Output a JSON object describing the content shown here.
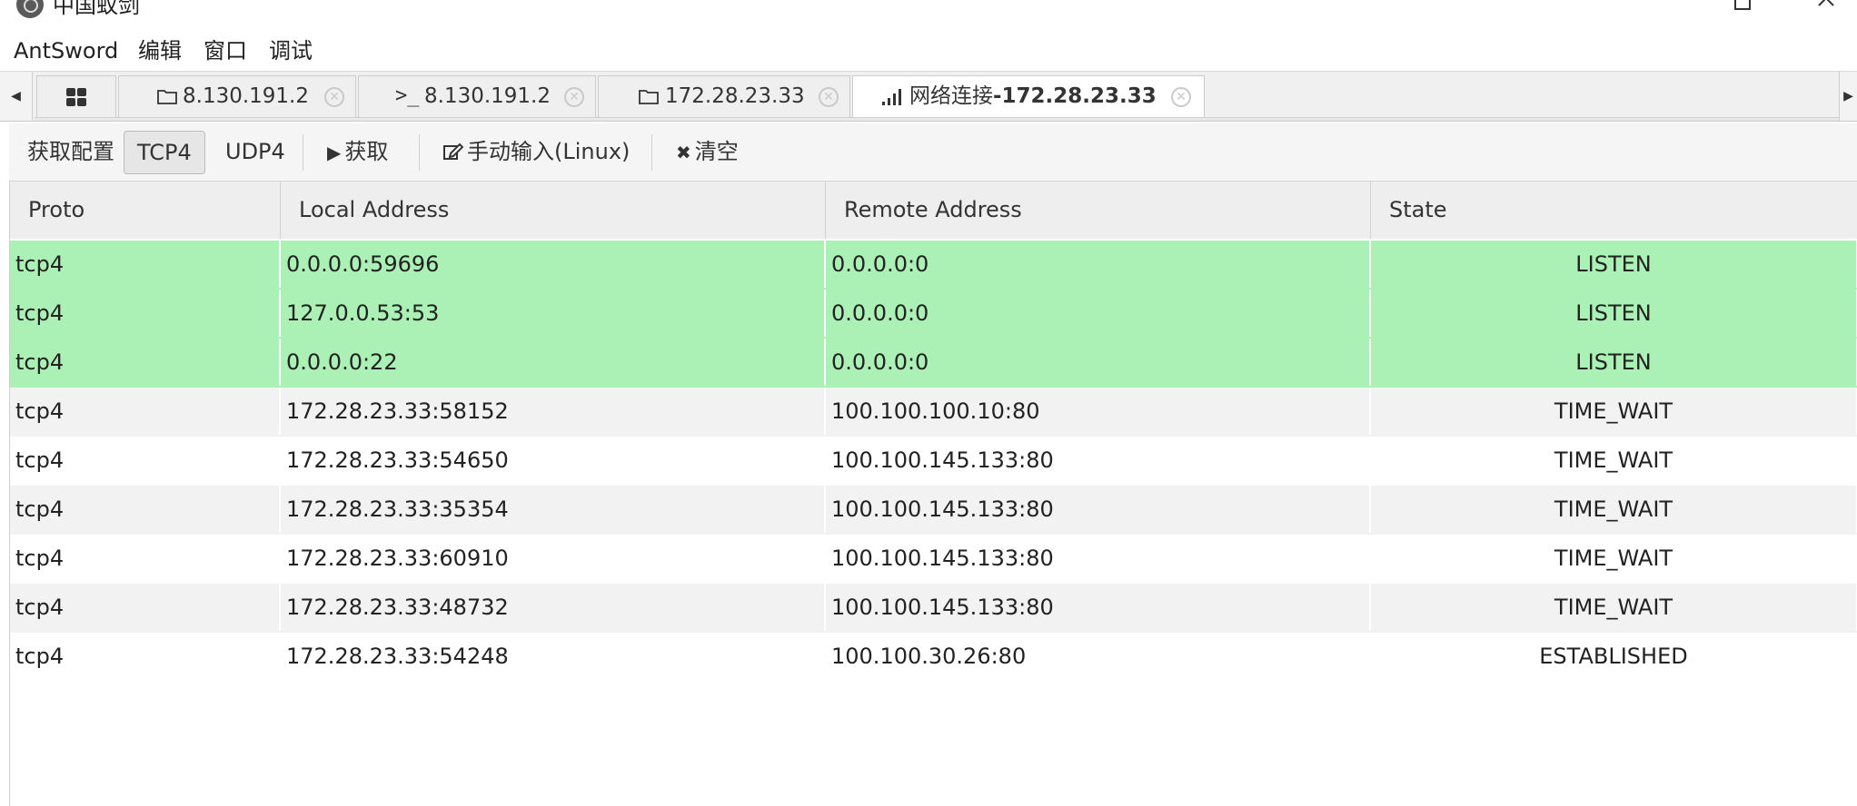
{
  "window": {
    "title": "中国蚁剑",
    "minimize_glyph": "—",
    "close_glyph": "✕"
  },
  "menu": {
    "items": [
      "AntSword",
      "编辑",
      "窗口",
      "调试"
    ]
  },
  "tabs": {
    "left_arrow": "◀",
    "right_arrow": "▶",
    "home_icon": "grid-icon",
    "items": [
      {
        "icon": "folder-icon",
        "label": "8.130.191.2"
      },
      {
        "icon": "terminal-icon",
        "label": "8.130.191.2"
      },
      {
        "icon": "folder-icon",
        "label": "172.28.23.33"
      },
      {
        "icon": "signal-icon",
        "label_prefix": "网络连接",
        "label_bold": "-172.28.23.33",
        "active": true
      }
    ],
    "close_glyph": "✕"
  },
  "toolbar": {
    "config_label": "获取配置",
    "tcp4_label": "TCP4",
    "udp4_label": "UDP4",
    "fetch_label": "获取",
    "fetch_icon": "▶",
    "manual_label": "手动输入(Linux)",
    "manual_icon": "edit-icon",
    "clear_label": "清空",
    "clear_icon": "✖"
  },
  "table": {
    "columns": [
      "Proto",
      "Local Address",
      "Remote Address",
      "State"
    ],
    "rows": [
      {
        "proto": "tcp4",
        "local": "0.0.0.0:59696",
        "remote": "0.0.0.0:0",
        "state": "LISTEN",
        "highlight": "green"
      },
      {
        "proto": "tcp4",
        "local": "127.0.0.53:53",
        "remote": "0.0.0.0:0",
        "state": "LISTEN",
        "highlight": "green"
      },
      {
        "proto": "tcp4",
        "local": "0.0.0.0:22",
        "remote": "0.0.0.0:0",
        "state": "LISTEN",
        "highlight": "green"
      },
      {
        "proto": "tcp4",
        "local": "172.28.23.33:58152",
        "remote": "100.100.100.10:80",
        "state": "TIME_WAIT",
        "highlight": "alt"
      },
      {
        "proto": "tcp4",
        "local": "172.28.23.33:54650",
        "remote": "100.100.145.133:80",
        "state": "TIME_WAIT",
        "highlight": "plain"
      },
      {
        "proto": "tcp4",
        "local": "172.28.23.33:35354",
        "remote": "100.100.145.133:80",
        "state": "TIME_WAIT",
        "highlight": "alt"
      },
      {
        "proto": "tcp4",
        "local": "172.28.23.33:60910",
        "remote": "100.100.145.133:80",
        "state": "TIME_WAIT",
        "highlight": "plain"
      },
      {
        "proto": "tcp4",
        "local": "172.28.23.33:48732",
        "remote": "100.100.145.133:80",
        "state": "TIME_WAIT",
        "highlight": "alt"
      },
      {
        "proto": "tcp4",
        "local": "172.28.23.33:54248",
        "remote": "100.100.30.26:80",
        "state": "ESTABLISHED",
        "highlight": "plain"
      }
    ]
  },
  "colors": {
    "listen_row": "#abf0b5",
    "alt_row": "#f2f2f2"
  }
}
